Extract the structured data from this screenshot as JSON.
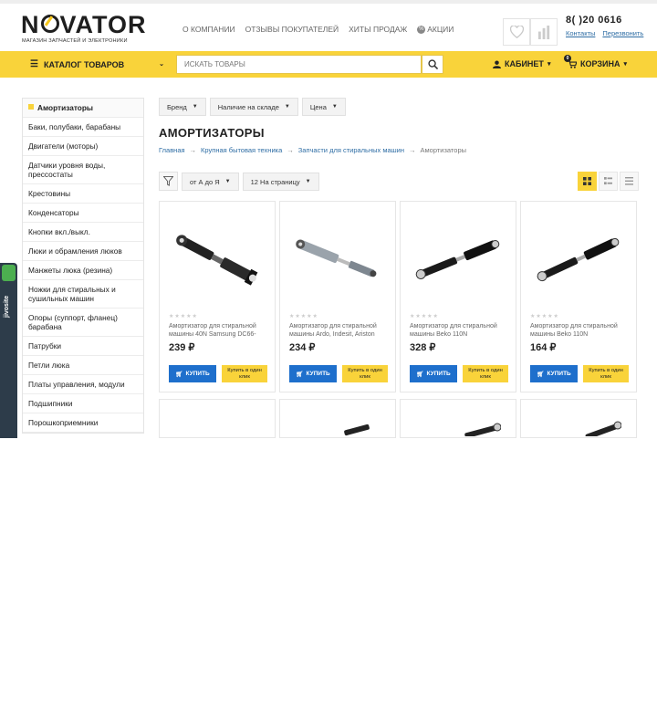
{
  "header": {
    "logo": "NOVATOR",
    "logo_pre": "N",
    "logo_post": "VATOR",
    "tagline": "МАГАЗИН ЗАПЧАСТЕЙ И ЭЛЕКТРОНИКИ",
    "nav": [
      "О КОМПАНИИ",
      "ОТЗЫВЫ ПОКУПАТЕЛЕЙ",
      "ХИТЫ ПРОДАЖ",
      "АКЦИИ"
    ],
    "sale_icon": "%",
    "phone": "8(   )20 0616",
    "contacts_link": "Контакты",
    "callback_link": "Перезвонить",
    "wishlist_icon": "heart-icon",
    "compare_icon": "bar-chart-icon"
  },
  "toolbar": {
    "catalog_label": "КАТАЛОГ ТОВАРОВ",
    "search_placeholder": "ИСКАТЬ ТОВАРЫ",
    "cabinet_label": "КАБИНЕТ",
    "cart_label": "КОРЗИНА",
    "cart_count": "0"
  },
  "sidebar": {
    "items": [
      {
        "label": "Амортизаторы",
        "active": true
      },
      {
        "label": "Баки, полубаки, барабаны"
      },
      {
        "label": "Двигатели (моторы)"
      },
      {
        "label": "Датчики уровня воды, прессостаты"
      },
      {
        "label": "Крестовины"
      },
      {
        "label": "Конденсаторы"
      },
      {
        "label": "Кнопки вкл./выкл."
      },
      {
        "label": "Люки и обрамления люков"
      },
      {
        "label": "Манжеты люка (резина)"
      },
      {
        "label": "Ножки для стиральных и сушильных машин"
      },
      {
        "label": "Опоры (суппорт, фланец) барабана"
      },
      {
        "label": "Патрубки"
      },
      {
        "label": "Петли люка"
      },
      {
        "label": "Платы управления, модули"
      },
      {
        "label": "Подшипники"
      },
      {
        "label": "Порошкоприемники"
      }
    ]
  },
  "feedback": {
    "text": "Напишите нам, мы онлайн!",
    "brand": "jivosite"
  },
  "filters": {
    "brand": "Бренд",
    "stock": "Наличие на складе",
    "price": "Цена"
  },
  "page": {
    "title": "АМОРТИЗАТОРЫ",
    "breadcrumb": [
      "Главная",
      "Крупная бытовая техника",
      "Запчасти для стиральных машин",
      "Амортизаторы"
    ],
    "separator": "→",
    "sort": "от А до Я",
    "per_page": "12 На страницу"
  },
  "products": [
    {
      "name": "Амортизатор для стиральной машины 40N Samsung DC66-",
      "price": "239",
      "currency": "₽"
    },
    {
      "name": "Амортизатор для стиральной машины Ardo, Indesit, Ariston",
      "price": "234",
      "currency": "₽"
    },
    {
      "name": "Амортизатор для стиральной машины Beko 110N",
      "price": "328",
      "currency": "₽"
    },
    {
      "name": "Амортизатор для стиральной машины Beko 110N",
      "price": "164",
      "currency": "₽"
    }
  ],
  "product_buttons": {
    "buy": "КУПИТЬ",
    "one_click": "Купить в один клик"
  },
  "stars": "★★★★★",
  "colors": {
    "accent_yellow": "#f9d33a",
    "buy_blue": "#1e6fcc",
    "link_blue": "#2e6da4"
  }
}
